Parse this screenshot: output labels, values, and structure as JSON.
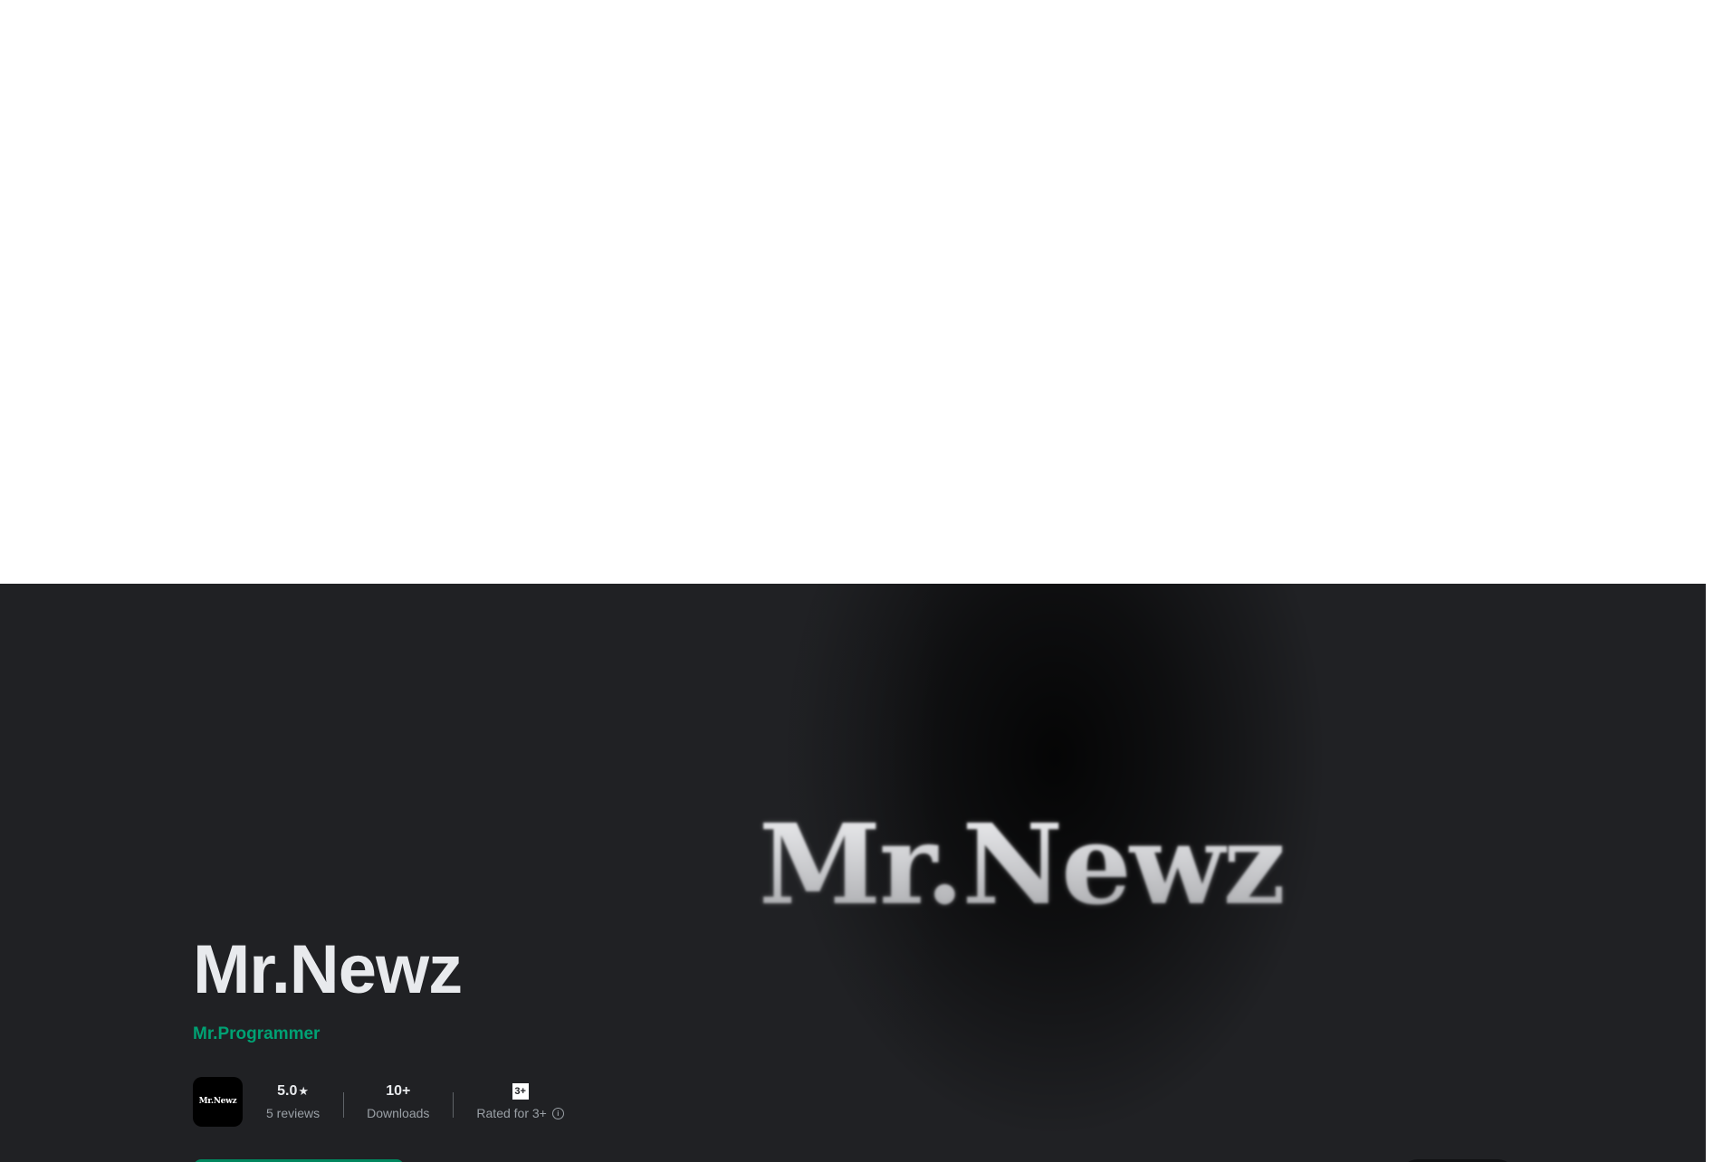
{
  "app": {
    "title": "Mr.Newz",
    "developer": "Mr.Programmer",
    "icon_text": "Mr.Newz",
    "feature_graphic_text": "Mr.Newz"
  },
  "stats": {
    "rating": {
      "value": "5.0",
      "icon": "star-icon",
      "label": "5 reviews"
    },
    "downloads": {
      "value": "10+",
      "label": "Downloads"
    },
    "content_rating": {
      "badge": "3+",
      "label": "Rated for 3+",
      "icon": "info-icon"
    }
  },
  "colors": {
    "background": "#202124",
    "accent": "#01875f",
    "developer_link": "#00a173",
    "title": "#e8eaed",
    "secondary_text": "#9aa0a6"
  }
}
